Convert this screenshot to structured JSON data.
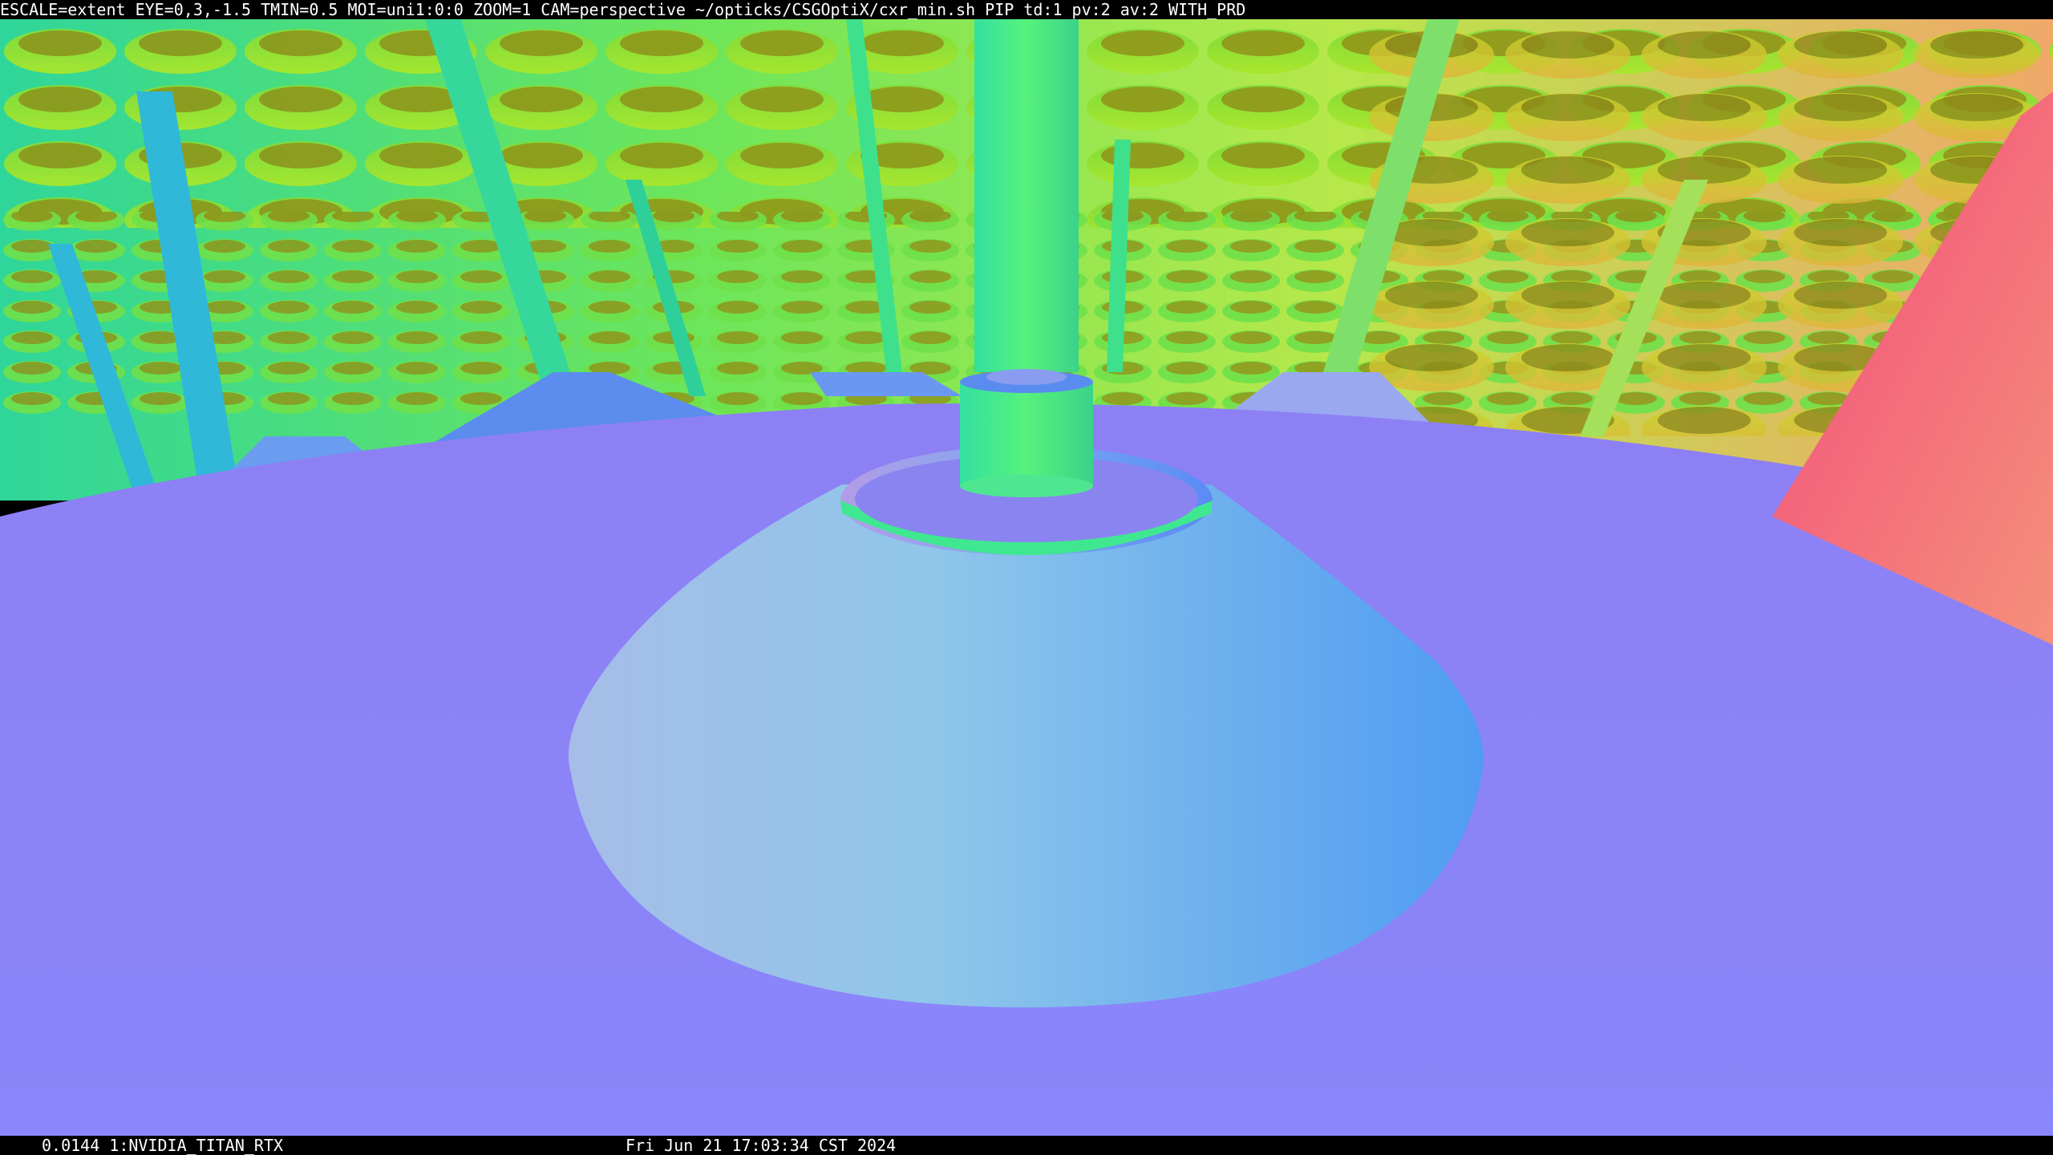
{
  "top_status": "ESCALE=extent EYE=0,3,-1.5 TMIN=0.5 MOI=uni1:0:0 ZOOM=1 CAM=perspective ~/opticks/CSGOptiX/cxr_min.sh PIP  td:1 pv:2 av:2 WITH_PRD",
  "bottom_status": {
    "frame_time": "0.0144 1:NVIDIA_TITAN_RTX",
    "timestamp": "Fri Jun 21 17:03:34 CST 2024"
  },
  "scene": {
    "description_icon": "raytraced-normal-shaded-geometry",
    "colors": {
      "floor": "#8a84fa",
      "cone_light": "#8fc6ea",
      "cone_dark": "#5aa6f0",
      "green": "#3ff08a",
      "yellowgreen": "#a6e22a",
      "olive": "#8f9a1a",
      "pink": "#f25b80",
      "teal": "#2ad1b0"
    }
  }
}
